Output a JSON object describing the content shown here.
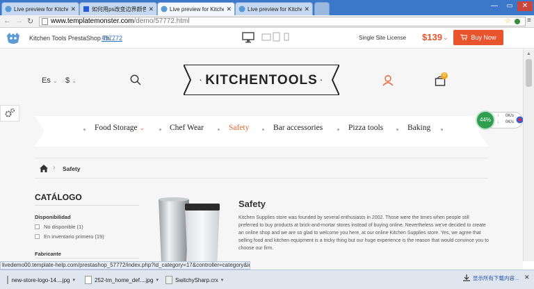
{
  "browser": {
    "tabs": [
      {
        "title": "Live preview for Kitchen",
        "active": false
      },
      {
        "title": "如何用ps改变边界颜色_百",
        "active": false
      },
      {
        "title": "Live preview for Kitchen",
        "active": true
      },
      {
        "title": "Live preview for Kitchen",
        "active": false
      }
    ],
    "url_host": "www.templatemonster.com",
    "url_path": "/demo/57772.html"
  },
  "preview_bar": {
    "product_title": "Kitchen Tools PrestaShop Th...",
    "product_id": "#57772",
    "license": "Single Site License",
    "price": "$139",
    "buy_label": "Buy Now"
  },
  "header": {
    "language": "Es",
    "currency": "$",
    "logo_text": "KITCHENTOOLS",
    "cart_count": "0"
  },
  "menu": [
    {
      "label": "Food Storage",
      "has_dropdown": true,
      "active": false
    },
    {
      "label": "Chef Wear",
      "has_dropdown": false,
      "active": false
    },
    {
      "label": "Safety",
      "has_dropdown": false,
      "active": true
    },
    {
      "label": "Bar accessories",
      "has_dropdown": false,
      "active": false
    },
    {
      "label": "Pizza tools",
      "has_dropdown": false,
      "active": false
    },
    {
      "label": "Baking",
      "has_dropdown": false,
      "active": false
    }
  ],
  "breadcrumb": {
    "current": "Safety"
  },
  "sidebar": {
    "title": "CATÁLOGO",
    "availability_title": "Disponibilidad",
    "availability_options": [
      "No disponible (1)",
      "En inventario primero (19)"
    ],
    "manufacturer_title": "Fabricante"
  },
  "category": {
    "title": "Safety",
    "description": "Kitchen Supplies store was founded by several enthusiasts in 2002. Those were the times when people still preferred to buy products at brick-and-mortar stores instead of buying online. Nevertheless we've decided to create an online shop and we are so glad to welcome you here, at our online Kitchen Supplies store. Yes, we agree that selling food and kitchen equipment is a tricky thing but our huge experience is the reason that would convince you to choose our firm."
  },
  "speed_widget": {
    "percent": "44%",
    "up": "0K/s",
    "down": "0K/s"
  },
  "status_url": "livedemo00.template-help.com/prestashop_57772/index.php?id_category=17&controller=category&id_lang=4#",
  "downloads": [
    {
      "name": "new-store-logo-14....jpg"
    },
    {
      "name": "252-tm_home_def....jpg"
    },
    {
      "name": "SwitchySharp.crx"
    }
  ],
  "downloads_show_all": "显示所有下载内容...",
  "colors": {
    "accent": "#e8632d",
    "tab_strip": "#3d77c9",
    "buy_button": "#e8542b"
  }
}
